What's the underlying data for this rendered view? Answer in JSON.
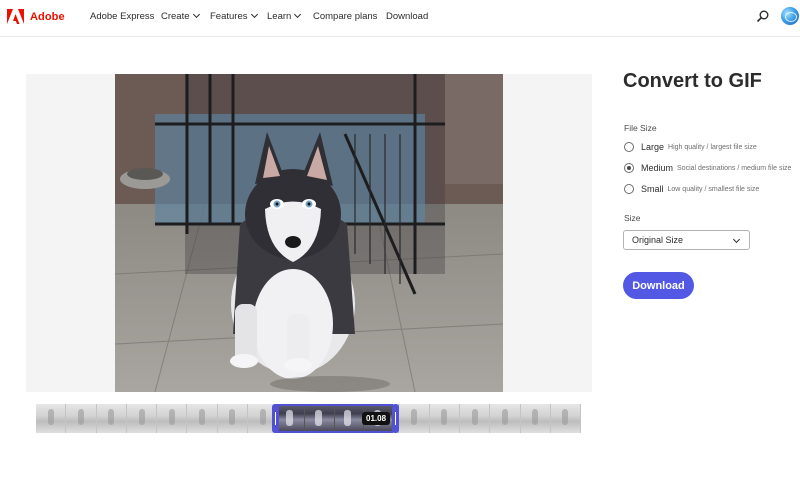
{
  "nav": {
    "brand": "Adobe",
    "items": [
      {
        "label": "Adobe Express",
        "dropdown": false
      },
      {
        "label": "Create",
        "dropdown": true
      },
      {
        "label": "Features",
        "dropdown": true
      },
      {
        "label": "Learn",
        "dropdown": true
      },
      {
        "label": "Compare plans",
        "dropdown": false
      },
      {
        "label": "Download",
        "dropdown": false
      }
    ],
    "icons": [
      "search-icon",
      "avatar"
    ]
  },
  "panel": {
    "title": "Convert to GIF",
    "file_size_label": "File Size",
    "file_size_options": [
      {
        "name": "Large",
        "desc": "High quality / largest file size",
        "selected": false
      },
      {
        "name": "Medium",
        "desc": "Social destinations / medium file size",
        "selected": true
      },
      {
        "name": "Small",
        "desc": "Low quality / smallest file size",
        "selected": false
      }
    ],
    "size_label": "Size",
    "size_value": "Original Size",
    "download_label": "Download"
  },
  "timeline": {
    "current_time": "01.08"
  },
  "colors": {
    "brand_red": "#eb1000",
    "accent": "#5258e4",
    "trim_handle": "#5151d3"
  }
}
